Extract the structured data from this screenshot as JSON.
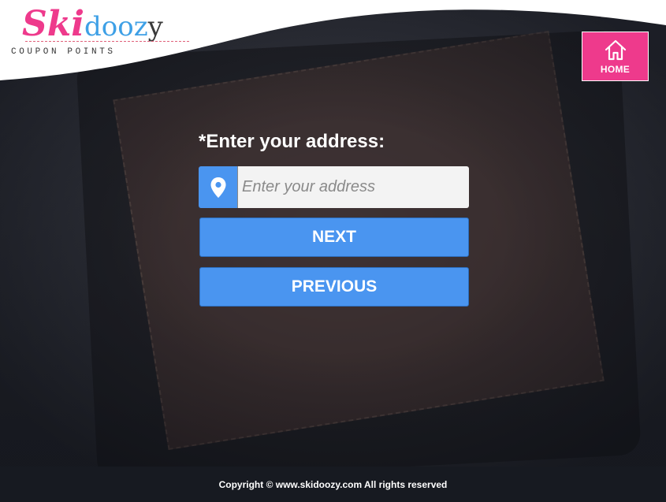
{
  "logo": {
    "brand_pink": "Ski",
    "brand_blue": "dooz",
    "brand_dark": "y",
    "tagline": "COUPON POINTS"
  },
  "home_button": {
    "label": "HOME",
    "icon": "home-icon"
  },
  "form": {
    "address_label": "*Enter your address:",
    "address_input": {
      "value": "",
      "placeholder": "Enter your address",
      "icon": "map-pin-icon"
    },
    "next_label": "NEXT",
    "previous_label": "PREVIOUS"
  },
  "footer": {
    "copyright": "Copyright © www.skidoozy.com All rights reserved"
  },
  "colors": {
    "brand_pink": "#ee3a8c",
    "brand_blue": "#3ea0e6",
    "button_blue": "#4a95f0",
    "footer_bg": "#171a21"
  }
}
